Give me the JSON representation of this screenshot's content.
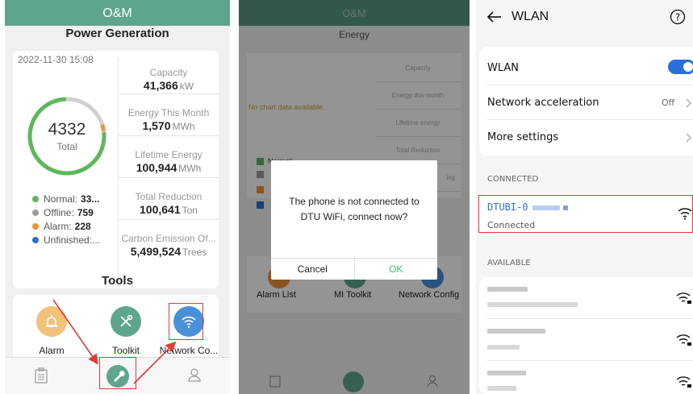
{
  "panel1": {
    "app_title": "O&M",
    "page_title": "Power Generation",
    "timestamp": "2022-11-30 15:08",
    "total_value": "4332",
    "total_label": "Total",
    "legend": [
      {
        "label": "Normal:",
        "value": "33...",
        "color": "#5cb85c"
      },
      {
        "label": "Offline:",
        "value": "759",
        "color": "#9e9e9e"
      },
      {
        "label": "Alarm:",
        "value": "228",
        "color": "#f0923a"
      },
      {
        "label": "Unfinished:...",
        "value": "",
        "color": "#2f6fc6"
      }
    ],
    "metrics": [
      {
        "label": "Capacity",
        "value": "41,366",
        "unit": "kW"
      },
      {
        "label": "Energy This Month",
        "value": "1,570",
        "unit": "MWh"
      },
      {
        "label": "Lifetime Energy",
        "value": "100,944",
        "unit": "MWh"
      },
      {
        "label": "Total Reduction",
        "value": "100,641",
        "unit": "Ton"
      },
      {
        "label": "Carbon Emission Of...",
        "value": "5,499,524",
        "unit": "Trees"
      }
    ],
    "tools_title": "Tools",
    "tools": [
      "Alarm",
      "Toolkit",
      "Network Co..."
    ]
  },
  "panel2": {
    "app_title": "O&M",
    "section": "Energy",
    "no_chart": "No chart data available.",
    "metrics": [
      "Capacity",
      "Energy this month",
      "Lifetime energy",
      "Total Reduction",
      "ing"
    ],
    "legend_text": "Normal:",
    "tools": [
      "Alarm List",
      "MI Toolkit",
      "Network Config"
    ],
    "dialog_message": "The phone is not connected to DTU WiFi, connect now?",
    "cancel_label": "Cancel",
    "ok_label": "OK"
  },
  "panel3": {
    "title": "WLAN",
    "wlan_label": "WLAN",
    "wlan_enabled": true,
    "accel_label": "Network acceleration",
    "accel_value": "Off",
    "more_label": "More settings",
    "connected_header": "CONNECTED",
    "connected_ssid": "DTUBI-0",
    "connected_status": "Connected",
    "available_header": "AVAILABLE"
  },
  "colors": {
    "brand_green": "#5ea58d",
    "annotation_red": "#e23a3a",
    "toggle_blue": "#2a6fdb",
    "ok_green": "#3cb96a"
  }
}
